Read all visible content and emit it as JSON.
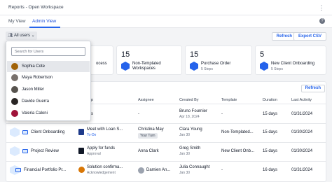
{
  "header": {
    "title": "Reports - Open Workspace",
    "menu_icon": "more-vertical-icon"
  },
  "tabs": [
    {
      "label": "My View"
    },
    {
      "label": "Admin View"
    }
  ],
  "toolbar": {
    "users_filter": "All users",
    "refresh": "Refresh",
    "export": "Export CSV",
    "help_icon": "?"
  },
  "dropdown": {
    "search_placeholder": "Search for Users",
    "users": [
      {
        "name": "Sophia Cote"
      },
      {
        "name": "Maya Robertson"
      },
      {
        "name": "Jason Miller"
      },
      {
        "name": "Davide Guerra"
      },
      {
        "name": "Valeria Caloni"
      }
    ]
  },
  "cards": [
    {
      "number": "",
      "label": "ocess",
      "sub": ""
    },
    {
      "number": "15",
      "label": "Non-Templated\nWorkspaces",
      "sub": ""
    },
    {
      "number": "15",
      "label": "Purchase Order",
      "sub": "5 Steps"
    },
    {
      "number": "5",
      "label": "New Client Onboarding",
      "sub": "5 Steps"
    }
  ],
  "grid": {
    "refresh": "Refresh",
    "headers": [
      "p",
      "Assignee",
      "Created By",
      "Template",
      "Duration",
      "Last Activity"
    ],
    "rows": [
      {
        "workspace": "",
        "step": "s",
        "step_sub": "",
        "assignee": "-",
        "assignee_pill": "",
        "created_by": "Bruno Fournier",
        "created_date": "Apr 18, 2024",
        "template": "-",
        "duration": "15 days",
        "last_activity": "01/31/2024"
      },
      {
        "workspace": "Client Onboarding",
        "step": "Meet with Loan S...",
        "step_sub": "To-Do",
        "assignee": "Christina May",
        "assignee_pill": "Your Turn",
        "created_by": "Clara Young",
        "created_date": "Jan 30",
        "template": "Non-Templated...",
        "duration": "15 days",
        "last_activity": "01/30/2024"
      },
      {
        "workspace": "Project Review",
        "step": "Apply for funds",
        "step_sub": "Approval",
        "assignee": "Anna Clark",
        "assignee_pill": "",
        "created_by": "Greg Smith",
        "created_date": "Jan 30",
        "template": "New Client Onb...",
        "duration": "15 days",
        "last_activity": "01/30/2024"
      },
      {
        "workspace": "Financial Portfolio Pr...",
        "step": "Solution confirma...",
        "step_sub": "Acknowledgement",
        "assignee": "Damien An...",
        "assignee_pill": "",
        "created_by": "Julia Connaught",
        "created_date": "Jan 30",
        "template": "-",
        "duration": "16 days",
        "last_activity": "01/31/2024"
      }
    ]
  },
  "colors": {
    "accent": "#2563eb",
    "hex_icon": "#2563eb"
  }
}
